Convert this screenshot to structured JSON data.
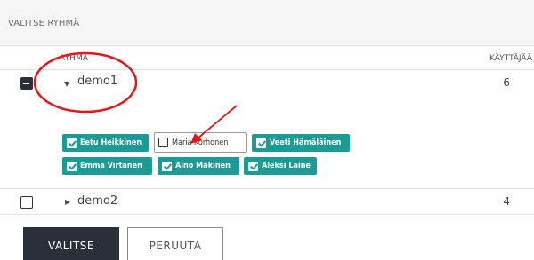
{
  "panel": {
    "title": "VALITSE RYHMÄ"
  },
  "table": {
    "columns": {
      "group": "RYHMÄ",
      "users": "KÄYTTÄJÄÄ"
    },
    "groups": [
      {
        "name": "demo1",
        "user_count": "6",
        "expanded": true,
        "selection": "partial",
        "members": [
          {
            "name": "Eetu Heikkinen",
            "checked": true
          },
          {
            "name": "Maria Korhonen",
            "checked": false
          },
          {
            "name": "Veeti Hämäläinen",
            "checked": true
          },
          {
            "name": "Emma Virtanen",
            "checked": true
          },
          {
            "name": "Aino Mäkinen",
            "checked": true
          },
          {
            "name": "Aleksi Laine",
            "checked": true
          }
        ]
      },
      {
        "name": "demo2",
        "user_count": "4",
        "expanded": false,
        "selection": "none"
      }
    ]
  },
  "actions": {
    "select_label": "VALITSE",
    "cancel_label": "PERUUTA"
  },
  "icons": {
    "expanded_caret": "caret-down-icon",
    "collapsed_caret": "caret-right-icon",
    "checkbox_partial": "checkbox-indeterminate-icon",
    "checkbox_empty": "checkbox-empty-icon",
    "chip_check": "checkmark-icon"
  },
  "annotations": {
    "highlight_color": "#e3161b"
  },
  "colors": {
    "chip_selected": "#1c9a96",
    "primary_button": "#2a2f3a",
    "header_background": "#f6f6f6"
  }
}
